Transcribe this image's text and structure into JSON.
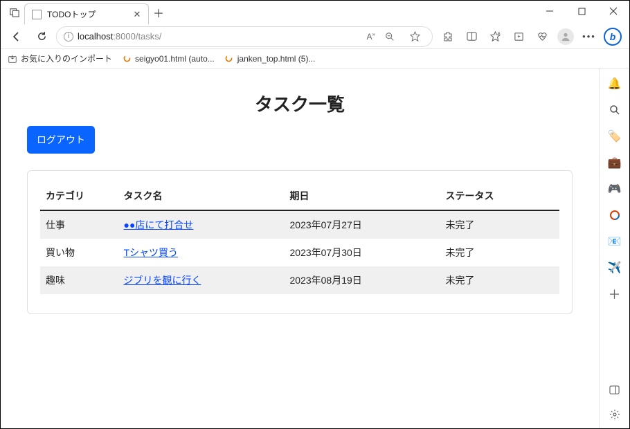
{
  "browser": {
    "tab_title": "TODOトップ",
    "url_prefix": "localhost",
    "url_suffix": ":8000/tasks/",
    "bookmarks": [
      {
        "label": "お気に入りのインポート",
        "icon": "import"
      },
      {
        "label": "seigyo01.html (auto...",
        "icon": "spin"
      },
      {
        "label": "janken_top.html (5)...",
        "icon": "spin"
      }
    ]
  },
  "page": {
    "title": "タスク一覧",
    "logout_label": "ログアウト",
    "columns": {
      "category": "カテゴリ",
      "name": "タスク名",
      "due": "期日",
      "status": "ステータス"
    },
    "tasks": [
      {
        "category": "仕事",
        "name": "●●店にて打合せ",
        "due": "2023年07月27日",
        "status": "未完了"
      },
      {
        "category": "買い物",
        "name": "Tシャツ買う",
        "due": "2023年07月30日",
        "status": "未完了"
      },
      {
        "category": "趣味",
        "name": "ジブリを観に行く",
        "due": "2023年08月19日",
        "status": "未完了"
      }
    ]
  }
}
